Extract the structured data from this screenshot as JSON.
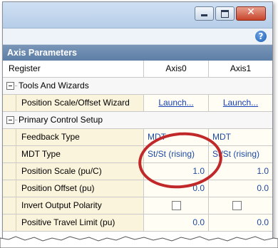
{
  "window": {
    "buttons": {
      "minimize": "minimize",
      "maximize": "maximize",
      "close": "✕"
    },
    "help_icon_glyph": "?"
  },
  "panel": {
    "title": "Axis Parameters"
  },
  "grid": {
    "columns": [
      "Register",
      "Axis0",
      "Axis1"
    ],
    "groups": [
      {
        "label": "Tools And Wizards",
        "rows": [
          {
            "label": "Position Scale/Offset Wizard",
            "axis0": "Launch...",
            "axis1": "Launch...",
            "kind": "link"
          }
        ]
      },
      {
        "label": "Primary Control Setup",
        "rows": [
          {
            "label": "Feedback Type",
            "axis0": "MDT",
            "axis1": "MDT",
            "kind": "text"
          },
          {
            "label": "MDT Type",
            "axis0": "St/St (rising)",
            "axis1": "St/St (rising)",
            "kind": "text"
          },
          {
            "label": "Position Scale (pu/C)",
            "axis0": "1.0",
            "axis1": "1.0",
            "kind": "number"
          },
          {
            "label": "Position Offset (pu)",
            "axis0": "0.0",
            "axis1": "0.0",
            "kind": "number"
          },
          {
            "label": "Invert Output Polarity",
            "axis0": false,
            "axis1": false,
            "kind": "checkbox"
          },
          {
            "label": "Positive Travel Limit (pu)",
            "axis0": "0.0",
            "axis1": "0.0",
            "kind": "number"
          }
        ]
      }
    ]
  },
  "colors": {
    "header_bg": "#6a88ad",
    "annotation_circle": "#c0282a",
    "value_text": "#1c4aa3"
  }
}
